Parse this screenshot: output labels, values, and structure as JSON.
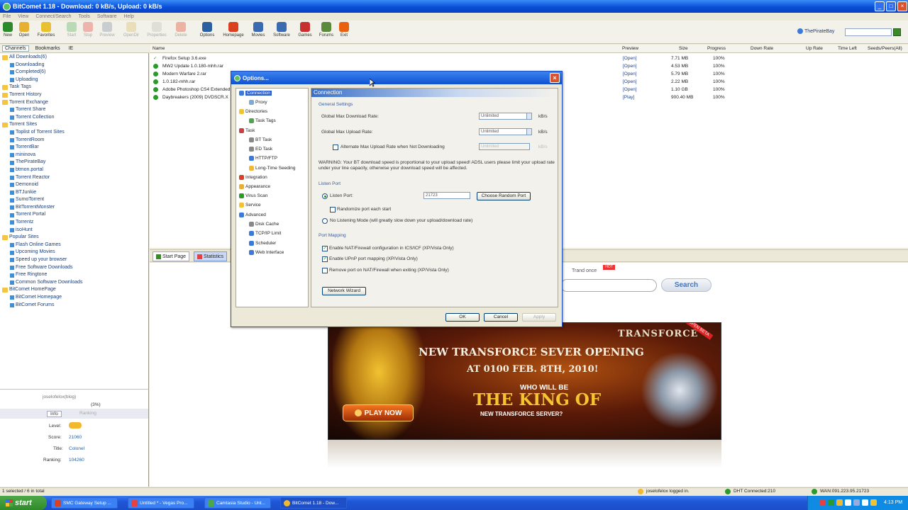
{
  "window": {
    "title": "BitComet 1.18 - Download: 0 kB/s, Upload: 0 kB/s",
    "btn_min": "_",
    "btn_max": "□",
    "btn_close": "×"
  },
  "menu": [
    "File",
    "View",
    "Connect/Search",
    "Tools",
    "Software",
    "Help"
  ],
  "toolbar": [
    {
      "label": "New",
      "color": "#2b8a2b"
    },
    {
      "label": "Open",
      "color": "#e8b030"
    },
    {
      "label": "Favorites",
      "color": "#e8c030"
    },
    {
      "label": "Start",
      "color": "#4caf50"
    },
    {
      "label": "Stop",
      "color": "#e84040"
    },
    {
      "label": "Preview",
      "color": "#7a8aa0"
    },
    {
      "label": "OpenDir",
      "color": "#d8b860"
    },
    {
      "label": "Properties",
      "color": "#bbbbbb"
    },
    {
      "label": "Delete",
      "color": "#e04020"
    },
    {
      "label": "Options",
      "color": "#2a5fa0"
    },
    {
      "label": "Homepage",
      "color": "#d84020"
    },
    {
      "label": "Movies",
      "color": "#3a6ab0"
    },
    {
      "label": "Software",
      "color": "#3a6ab0"
    },
    {
      "label": "Games",
      "color": "#c83030"
    },
    {
      "label": "Forums",
      "color": "#5a8a3a"
    },
    {
      "label": "Exit",
      "color": "#e86010"
    }
  ],
  "search_top": {
    "engine": "ThePirateBay"
  },
  "left_tabs": [
    "Channels",
    "Bookmarks",
    "IE"
  ],
  "tree": [
    {
      "label": "All Downloads(6)",
      "level": 0
    },
    {
      "label": "Downloading",
      "level": 1
    },
    {
      "label": "Completed(6)",
      "level": 1
    },
    {
      "label": "Uploading",
      "level": 1
    },
    {
      "label": "Task Tags",
      "level": 0
    },
    {
      "label": "Torrent History",
      "level": 0
    },
    {
      "label": "Torrent Exchange",
      "level": 0
    },
    {
      "label": "Torrent Share",
      "level": 1
    },
    {
      "label": "Torrent Collection",
      "level": 1
    },
    {
      "label": "Torrent Sites",
      "level": 0
    },
    {
      "label": "Toplist of Torrent Sites",
      "level": 1
    },
    {
      "label": "TorrentRoom",
      "level": 1
    },
    {
      "label": "TorrentBar",
      "level": 1
    },
    {
      "label": "mininova",
      "level": 1
    },
    {
      "label": "ThePirateBay",
      "level": 1
    },
    {
      "label": "btmon.portal",
      "level": 1
    },
    {
      "label": "Torrent Reactor",
      "level": 1
    },
    {
      "label": "Demonoid",
      "level": 1
    },
    {
      "label": "BTJunkie",
      "level": 1
    },
    {
      "label": "SumoTorrent",
      "level": 1
    },
    {
      "label": "BitTorrentMonster",
      "level": 1
    },
    {
      "label": "Torrent Portal",
      "level": 1
    },
    {
      "label": "Torrentz",
      "level": 1
    },
    {
      "label": "isoHunt",
      "level": 1
    },
    {
      "label": "Popular Sites",
      "level": 0
    },
    {
      "label": "Flash Online Games",
      "level": 1
    },
    {
      "label": "Upcoming Movies",
      "level": 1
    },
    {
      "label": "Speed up your browser",
      "level": 1
    },
    {
      "label": "Free Software Downloads",
      "level": 1
    },
    {
      "label": "Free Ringtone",
      "level": 1
    },
    {
      "label": "Common Software Downloads",
      "level": 1
    },
    {
      "label": "BitComet HomePage",
      "level": 0
    },
    {
      "label": "BitComet Homepage",
      "level": 1
    },
    {
      "label": "BitComet Forums",
      "level": 1
    }
  ],
  "left_bottom": {
    "user": "joselofelox(blog)",
    "percent": "(3%)",
    "tab_info": "Info",
    "tab_ranking": "Ranking",
    "level_label": "Level:",
    "score_label": "Score:",
    "score": "21060",
    "title_label": "Title:",
    "title": "Colonel",
    "ranking_label": "Ranking:",
    "ranking": "104260"
  },
  "list": {
    "columns": {
      "name": "Name",
      "preview": "Preview",
      "size": "Size",
      "progress": "Progress",
      "down": "Down Rate",
      "up": "Up Rate",
      "time": "Time Left",
      "seeds": "Seeds/Peers(All)"
    },
    "rows": [
      {
        "name": "Firefox Setup 3.6.exe",
        "preview": "[Open]",
        "size": "7.71 MB",
        "progress": "100%"
      },
      {
        "name": "MW2 Update 1.0.180-mhh.rar",
        "preview": "[Open]",
        "size": "4.53 MB",
        "progress": "100%"
      },
      {
        "name": "Modern Warfare 2.rar",
        "preview": "[Open]",
        "size": "5.79 MB",
        "progress": "100%"
      },
      {
        "name": "1.0.182-mhh.rar",
        "preview": "[Open]",
        "size": "2.22 MB",
        "progress": "100%"
      },
      {
        "name": "Adobe Photoshop CS4 Extended",
        "preview": "[Open]",
        "size": "1.10 GB",
        "progress": "100%"
      },
      {
        "name": "Daybreakers (2009) DVDSCR.X",
        "preview": "[Play]",
        "size": "900.40 MB",
        "progress": "100%"
      }
    ]
  },
  "bottom_tabs": [
    "Start Page",
    "Statistics"
  ],
  "content": {
    "trand": "Trand once",
    "hot": "HOT",
    "search_btn": "Search"
  },
  "ad": {
    "brand": "TRANSFORCE",
    "beta": "OPEN BETA",
    "line1": "NEW TRANSFORCE SEVER OPENING",
    "line2": "AT 0100 FEB. 8TH, 2010!",
    "line3": "WHO WILL BE",
    "line4": "THE KING OF",
    "line5": "NEW TRANSFORCE SERVER?",
    "play": "PLAY NOW"
  },
  "dialog": {
    "title": "Options...",
    "close": "×",
    "tree": [
      "Connection",
      "Proxy",
      "Directories",
      "Task Tags",
      "Task",
      "BT Task",
      "ED Task",
      "HTTP/FTP",
      "Long-Time Seeding",
      "Integration",
      "Appearance",
      "Virus Scan",
      "Service",
      "Advanced",
      "Disk Cache",
      "TCP/IP Limit",
      "Scheduler",
      "Web Interface"
    ],
    "header": "Connection",
    "general_settings": "General Settings",
    "max_down_label": "Global Max Download Rate:",
    "max_down_value": "Unlimited",
    "unit1": "kB/s",
    "max_up_label": "Global Max Upload Rate:",
    "max_up_value": "Unlimited",
    "unit2": "kB/s",
    "alt_label": "Alternate Max Upload Rate when Not Downloading",
    "alt_value": "Unlimited",
    "unit3": "kB/s",
    "warning": "WARNING: Your BT download speed is proportional to your upload speed! ADSL users please limit your upload rate under your line capacity, otherwise your download speed will be affected.",
    "listen_port_section": "Listen Port",
    "listen_port_label": "Listen Port:",
    "listen_port_value": "21723",
    "random_port_btn": "Choose Random Port",
    "randomize_label": "Randomize port each start",
    "no_listen_label": "No Listening Mode (will greatly slow down your upload/download rate)",
    "port_mapping_section": "Port Mapping",
    "nat_label": "Enable NAT/Firewall configuration in ICS/ICF (XP/Vista Only)",
    "upnp_label": "Enable UPnP port mapping (XP/Vista Only)",
    "remove_label": "Remove port on NAT/Firewall when exiting (XP/Vista Only)",
    "wizard_btn": "Network Wizard",
    "ok": "OK",
    "cancel": "Cancel",
    "apply": "Apply"
  },
  "status": {
    "selected": "1 selected / 6 in total",
    "user": "joselofelox logged in.",
    "dht": "DHT Connected:210",
    "wan": "WAN:091.223.95.21723"
  },
  "taskbar": {
    "start": "start",
    "tasks": [
      "SMC Gateway Setup ...",
      "Untitled * - Vegas Pro...",
      "Camtasia Studio - Unt...",
      "BitComet 1.18 - Dow..."
    ],
    "clock": "4:13 PM"
  }
}
